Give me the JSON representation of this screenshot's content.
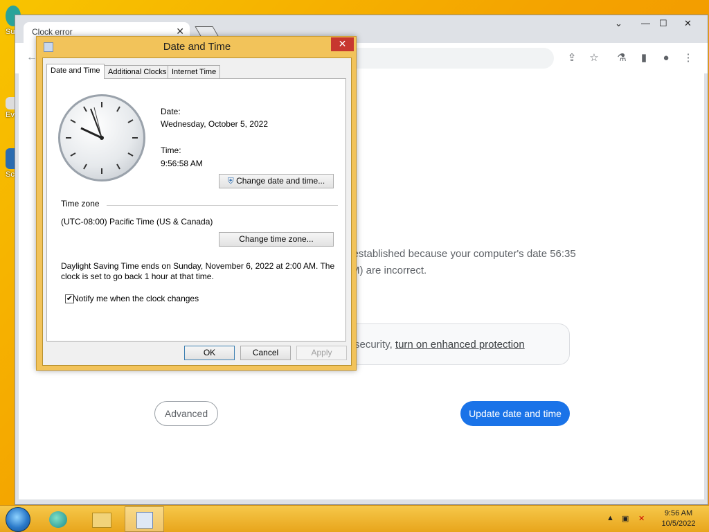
{
  "desktop": {
    "icons": [
      {
        "label": "Su"
      },
      {
        "label": "Ev"
      },
      {
        "label": "Sc"
      }
    ]
  },
  "browser": {
    "tab_title": "Clock error",
    "tab_close": "✕",
    "window_controls": {
      "minimize": "—",
      "maximize": "☐",
      "close": "✕",
      "dropdown": "⌄"
    },
    "toolbar_icons": [
      "share-icon",
      "star-icon",
      "lab-icon",
      "sidepanel-icon",
      "profile-icon",
      "menu-icon"
    ],
    "error_text": "e established because your computer's date 56:35 AM) are incorrect.",
    "protection_prefix": "security, ",
    "protection_link": "turn on enhanced protection",
    "advanced_label": "Advanced",
    "update_label": "Update date and time",
    "accent": "#1a73e8"
  },
  "dialog": {
    "title": "Date and Time",
    "close": "✕",
    "tabs": [
      "Date and Time",
      "Additional Clocks",
      "Internet Time"
    ],
    "date_label": "Date:",
    "date_value": "Wednesday, October 5, 2022",
    "time_label": "Time:",
    "time_value": "9:56:58 AM",
    "change_date_btn": "Change date and time...",
    "timezone_header": "Time zone",
    "timezone_value": "(UTC-08:00) Pacific Time (US & Canada)",
    "change_tz_btn": "Change time zone...",
    "dst_line1": "Daylight Saving Time ends on Sunday, November 6, 2022 at 2:00 AM. The",
    "dst_line2": "clock is set to go back 1 hour at that time.",
    "notify_label": "Notify me when the clock changes",
    "notify_checked": "✔",
    "ok": "OK",
    "cancel": "Cancel",
    "apply": "Apply"
  },
  "taskbar": {
    "time": "9:56 AM",
    "date": "10/5/2022",
    "tray_icons": [
      "show-hidden-icon",
      "network-icon",
      "volume-muted-icon"
    ]
  }
}
